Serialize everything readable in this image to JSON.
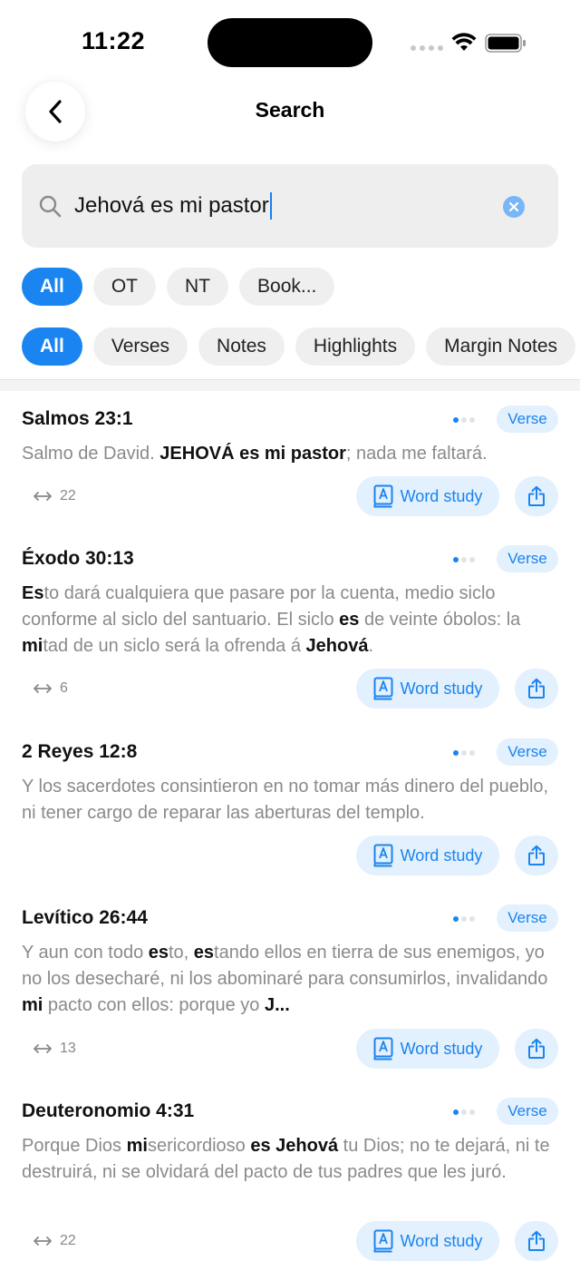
{
  "status_bar": {
    "time": "11:22"
  },
  "nav": {
    "title": "Search"
  },
  "search": {
    "value": "Jehová es mi pastor"
  },
  "testament_filters": [
    {
      "label": "All",
      "active": true
    },
    {
      "label": "OT",
      "active": false
    },
    {
      "label": "NT",
      "active": false
    },
    {
      "label": "Book...",
      "active": false
    }
  ],
  "type_filters": [
    {
      "label": "All",
      "active": true
    },
    {
      "label": "Verses",
      "active": false
    },
    {
      "label": "Notes",
      "active": false
    },
    {
      "label": "Highlights",
      "active": false
    },
    {
      "label": "Margin Notes",
      "active": false
    }
  ],
  "colors": {
    "accent": "#1a84f0",
    "accent_light": "#e3f0fd",
    "chip_bg": "#efefef",
    "text_muted": "#8a8a8a"
  },
  "results": [
    {
      "reference": "Salmos 23:1",
      "badge": "Verse",
      "segments": [
        {
          "t": "Salmo de David. ",
          "b": false
        },
        {
          "t": "JEHOVÁ es mi pastor",
          "b": true
        },
        {
          "t": "; nada me faltará.",
          "b": false
        }
      ],
      "cross_refs": "22",
      "word_study": "Word study"
    },
    {
      "reference": "Éxodo 30:13",
      "badge": "Verse",
      "segments": [
        {
          "t": "Es",
          "b": true
        },
        {
          "t": "to dará cualquiera que pasare por la cuenta, medio siclo conforme al siclo del santuario. El siclo ",
          "b": false
        },
        {
          "t": "es",
          "b": true
        },
        {
          "t": " de veinte óbolos: la ",
          "b": false
        },
        {
          "t": "mi",
          "b": true
        },
        {
          "t": "tad de un siclo será la ofrenda á ",
          "b": false
        },
        {
          "t": "Jehová",
          "b": true
        },
        {
          "t": ".",
          "b": false
        }
      ],
      "cross_refs": "6",
      "word_study": "Word study"
    },
    {
      "reference": "2 Reyes 12:8",
      "badge": "Verse",
      "segments": [
        {
          "t": "Y los sacerdotes consintieron en no tomar más dinero del pueblo, ni tener cargo de reparar las aberturas del templo.",
          "b": false
        }
      ],
      "cross_refs": "",
      "word_study": "Word study"
    },
    {
      "reference": "Levítico 26:44",
      "badge": "Verse",
      "segments": [
        {
          "t": "Y aun con todo ",
          "b": false
        },
        {
          "t": "es",
          "b": true
        },
        {
          "t": "to, ",
          "b": false
        },
        {
          "t": "es",
          "b": true
        },
        {
          "t": "tando ellos en tierra de sus enemigos, yo no los desecharé, ni los abominaré para consumirlos, invalidando ",
          "b": false
        },
        {
          "t": "mi",
          "b": true
        },
        {
          "t": " pacto con ellos: porque yo ",
          "b": false
        },
        {
          "t": "J...",
          "b": true
        }
      ],
      "cross_refs": "13",
      "word_study": "Word study"
    },
    {
      "reference": "Deuteronomio 4:31",
      "badge": "Verse",
      "segments": [
        {
          "t": "Porque Dios ",
          "b": false
        },
        {
          "t": "mi",
          "b": true
        },
        {
          "t": "sericordioso ",
          "b": false
        },
        {
          "t": "es Jehová",
          "b": true
        },
        {
          "t": " tu Dios; no te dejará, ni te destruirá, ni se olvidará del pacto de tus padres que les juró.",
          "b": false
        }
      ],
      "cross_refs": "22",
      "word_study": "Word study"
    }
  ]
}
